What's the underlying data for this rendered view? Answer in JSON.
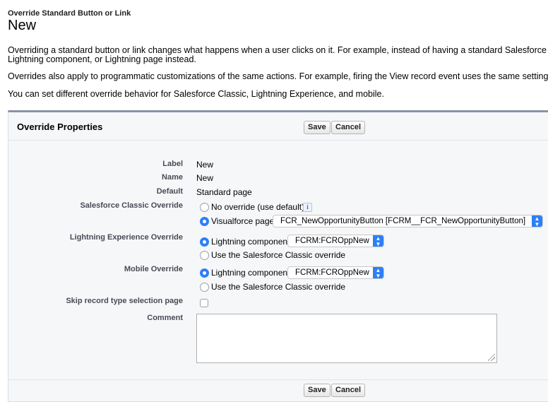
{
  "header": {
    "subtitle": "Override Standard Button or Link",
    "title": "New"
  },
  "intro": {
    "p1_line1": "Overriding a standard button or link changes what happens when a user clicks on it. For example, instead of having a standard Salesforce p",
    "p1_line2": "Lightning component, or Lightning page instead.",
    "p2": "Overrides also apply to programmatic customizations of the same actions. For example, firing the View record event uses the same setting, a",
    "p3": "You can set different override behavior for Salesforce Classic, Lightning Experience, and mobile."
  },
  "panel": {
    "title": "Override Properties",
    "save_label": "Save",
    "cancel_label": "Cancel"
  },
  "fields": {
    "label_label": "Label",
    "label_value": "New",
    "name_label": "Name",
    "name_value": "New",
    "default_label": "Default",
    "default_value": "Standard page",
    "classic_label": "Salesforce Classic Override",
    "classic_opt_none": "No override (use default)",
    "classic_opt_vf": "Visualforce page",
    "classic_vf_selected": "FCR_NewOpportunityButton [FCRM__FCR_NewOpportunityButton]",
    "lex_label": "Lightning Experience Override",
    "lex_opt_component": "Lightning component",
    "lex_component_selected": "FCRM:FCROppNew",
    "lex_opt_classic": "Use the Salesforce Classic override",
    "mobile_label": "Mobile Override",
    "mobile_opt_component": "Lightning component",
    "mobile_component_selected": "FCRM:FCROppNew",
    "mobile_opt_classic": "Use the Salesforce Classic override",
    "skip_label": "Skip record type selection page",
    "comment_label": "Comment",
    "comment_value": ""
  },
  "icons": {
    "info": "info-icon",
    "select_arrow": "updown-chevron-icon"
  },
  "colors": {
    "accent": "#2d7ff9",
    "panel_border_top": "#8a92a6",
    "label_text": "#4a4a56"
  }
}
